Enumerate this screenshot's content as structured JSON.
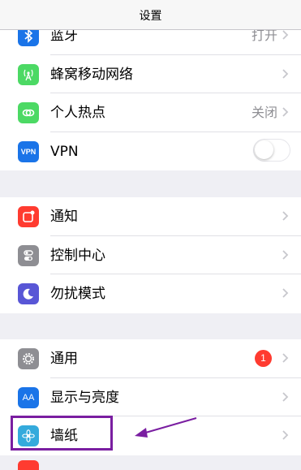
{
  "nav": {
    "title": "设置"
  },
  "group1": {
    "items": [
      {
        "label": "蓝牙",
        "value": "打开",
        "icon": "bluetooth-icon",
        "color": "#1a74e8"
      },
      {
        "label": "蜂窝移动网络",
        "value": "",
        "icon": "cellular-icon",
        "color": "#4cd964"
      },
      {
        "label": "个人热点",
        "value": "关闭",
        "icon": "hotspot-icon",
        "color": "#4cd964"
      },
      {
        "label": "VPN",
        "icon_text": "VPN",
        "icon": "vpn-icon",
        "color": "#1a74e8",
        "toggle_on": false
      }
    ]
  },
  "group2": {
    "items": [
      {
        "label": "通知",
        "icon": "notifications-icon",
        "color": "#ff3b30"
      },
      {
        "label": "控制中心",
        "icon": "control-center-icon",
        "color": "#8e8e93"
      },
      {
        "label": "勿扰模式",
        "icon": "moon-icon",
        "color": "#5856d6"
      }
    ]
  },
  "group3": {
    "items": [
      {
        "label": "通用",
        "badge": "1",
        "icon": "gear-icon",
        "color": "#8e8e93"
      },
      {
        "label": "显示与亮度",
        "icon_text": "AA",
        "icon": "display-icon",
        "color": "#1a74e8"
      },
      {
        "label": "墙纸",
        "icon": "wallpaper-icon",
        "color": "#34aadc"
      }
    ]
  },
  "annotation": {
    "color": "#7a1ea1"
  }
}
